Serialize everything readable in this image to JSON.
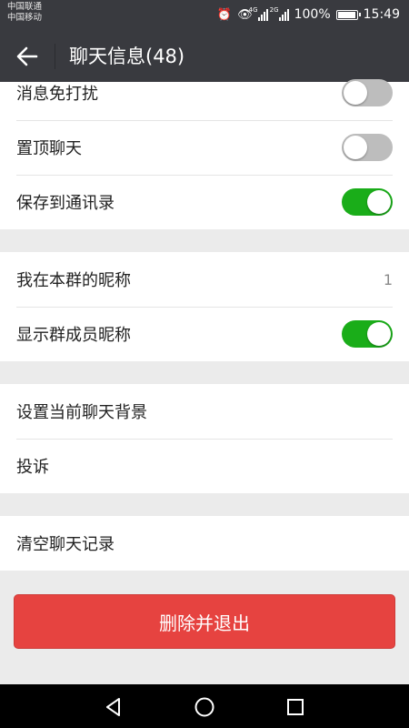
{
  "status": {
    "carrier1": "中国联通",
    "carrier2": "中国移动",
    "sim1_tag": "4G",
    "sim2_tag": "2G",
    "battery": "100%",
    "battery_level": 1.0,
    "time": "15:49"
  },
  "header": {
    "title": "聊天信息(48)"
  },
  "settings": {
    "mute_label": "消息免打扰",
    "mute_on": false,
    "pin_label": "置顶聊天",
    "pin_on": false,
    "save_contacts_label": "保存到通讯录",
    "save_contacts_on": true,
    "nickname_label": "我在本群的昵称",
    "nickname_value": "1",
    "show_nicknames_label": "显示群成员昵称",
    "show_nicknames_on": true,
    "background_label": "设置当前聊天背景",
    "report_label": "投诉",
    "clear_history_label": "清空聊天记录"
  },
  "actions": {
    "delete_exit_label": "删除并退出"
  },
  "colors": {
    "toggle_on": "#1aad19",
    "danger": "#e64340",
    "header": "#393a3f"
  }
}
